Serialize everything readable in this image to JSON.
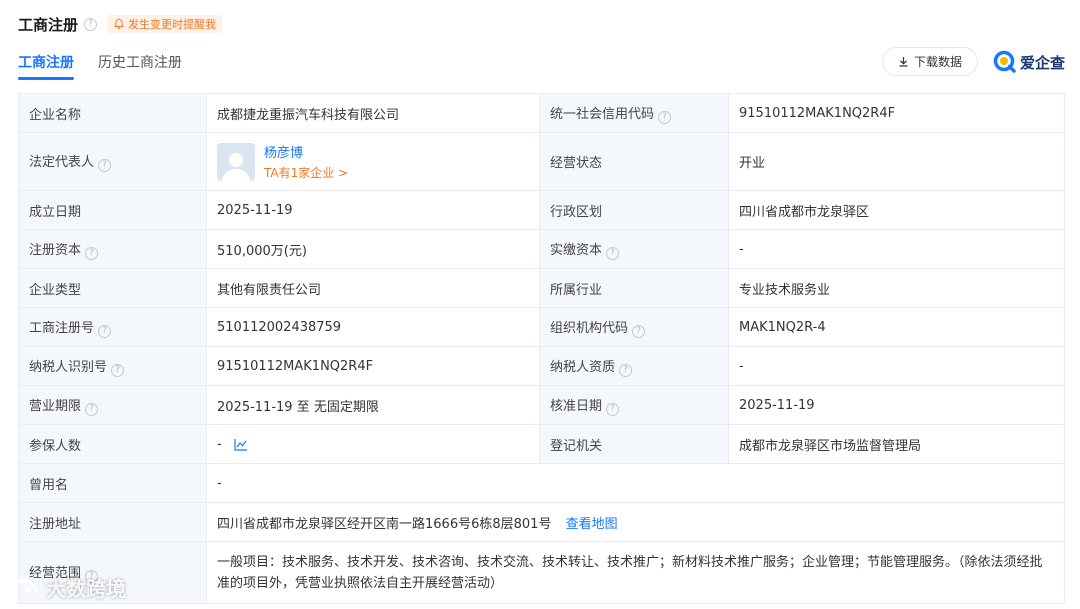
{
  "header": {
    "title": "工商注册",
    "help": "?",
    "alert_label": "发生变更时提醒我"
  },
  "tabs": [
    {
      "label": "工商注册",
      "active": true
    },
    {
      "label": "历史工商注册",
      "active": false
    }
  ],
  "toolbar": {
    "download_label": "下载数据",
    "download_icon": "download-icon",
    "brand_label": "爱企查"
  },
  "info": {
    "company_name": {
      "label": "企业名称",
      "value": "成都捷龙重振汽车科技有限公司"
    },
    "credit_code": {
      "label": "统一社会信用代码",
      "value": "91510112MAK1NQ2R4F"
    },
    "legal_rep": {
      "label": "法定代表人",
      "name": "杨彦博",
      "sub": "TA有1家企业 >"
    },
    "status": {
      "label": "经营状态",
      "value": "开业"
    },
    "founded": {
      "label": "成立日期",
      "value": "2025-11-19"
    },
    "region": {
      "label": "行政区划",
      "value": "四川省成都市龙泉驿区"
    },
    "reg_capital": {
      "label": "注册资本",
      "value": "510,000万(元)"
    },
    "paid_capital": {
      "label": "实缴资本",
      "value": "-"
    },
    "company_type": {
      "label": "企业类型",
      "value": "其他有限责任公司"
    },
    "industry": {
      "label": "所属行业",
      "value": "专业技术服务业"
    },
    "reg_number": {
      "label": "工商注册号",
      "value": "510112002438759"
    },
    "org_code": {
      "label": "组织机构代码",
      "value": "MAK1NQ2R-4"
    },
    "taxpayer_id": {
      "label": "纳税人识别号",
      "value": "91510112MAK1NQ2R4F"
    },
    "taxpayer_qual": {
      "label": "纳税人资质",
      "value": "-"
    },
    "term": {
      "label": "营业期限",
      "value": "2025-11-19 至 无固定期限"
    },
    "approval_date": {
      "label": "核准日期",
      "value": "2025-11-19"
    },
    "insured": {
      "label": "参保人数",
      "value": "-"
    },
    "authority": {
      "label": "登记机关",
      "value": "成都市龙泉驿区市场监督管理局"
    },
    "former_name": {
      "label": "曾用名",
      "value": "-"
    },
    "address": {
      "label": "注册地址",
      "value": "四川省成都市龙泉驿区经开区南一路1666号6栋8层801号",
      "link": "查看地图"
    },
    "scope": {
      "label": "经营范围",
      "value": "一般项目：技术服务、技术开发、技术咨询、技术交流、技术转让、技术推广；新材料技术推广服务；企业管理；节能管理服务。（除依法须经批准的项目外，凭营业执照依法自主开展经营活动）"
    }
  },
  "watermark": {
    "text": "大数跨境"
  },
  "colors": {
    "accent": "#1677ff",
    "orange": "#f07a23",
    "label_bg": "#f4f7fc",
    "border": "#e9ecf0"
  }
}
